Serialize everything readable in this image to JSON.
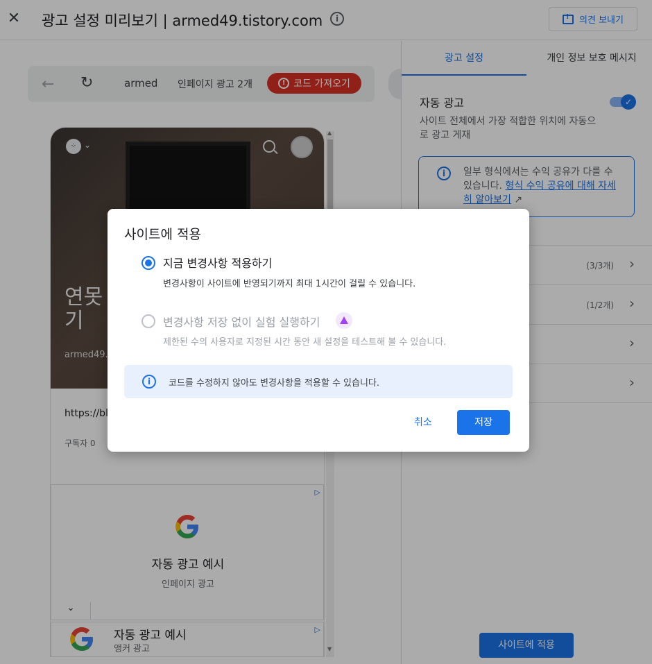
{
  "header": {
    "title": "광고 설정 미리보기 | armed49.tistory.com",
    "feedback_label": "의견 보내기"
  },
  "preview": {
    "toolbar": {
      "site_name": "armed",
      "inpage_count": "인페이지 광고 2개",
      "code_button": "코드 가져오기"
    },
    "blog": {
      "title": "연못기",
      "sub": "armed49.",
      "url": "https://bl",
      "subscribers": "구독자 0"
    },
    "ads": [
      {
        "title": "자동 광고 예시",
        "subtitle": "인페이지 광고"
      },
      {
        "title": "자동 광고 예시",
        "subtitle": "앵커 광고"
      }
    ]
  },
  "sidebar": {
    "tabs": [
      {
        "label": "광고 설정",
        "active": true
      },
      {
        "label": "개인 정보 보호 메시지",
        "active": false
      }
    ],
    "auto_ads": {
      "title": "자동 광고",
      "description": "사이트 전체에서 가장 적합한 위치에 자동으로 광고 게재",
      "enabled": true
    },
    "notice": {
      "text_prefix": "일부 형식에서는 수익 공유가 다를 수 있습니다.",
      "link": "형식 수익 공유에 대해 자세히 알아보기"
    },
    "rows": [
      {
        "count": "(3/3개)"
      },
      {
        "count": "(1/2개)"
      },
      {
        "count": ""
      },
      {
        "count": ""
      }
    ],
    "apply_button": "사이트에 적용"
  },
  "dialog": {
    "title": "사이트에 적용",
    "option1": {
      "label": "지금 변경사항 적용하기",
      "description": "변경사항이 사이트에 반영되기까지 최대 1시간이 걸릴 수 있습니다.",
      "selected": true
    },
    "option2": {
      "label": "변경사항 저장 없이 실험 실행하기",
      "description": "제한된 수의 사용자로 지정된 시간 동안 새 설정을 테스트해 볼 수 있습니다.",
      "selected": false
    },
    "info": "코드를 수정하지 않아도 변경사항을 적용할 수 있습니다.",
    "cancel": "취소",
    "save": "저장"
  },
  "colors": {
    "accent": "#1a73e8",
    "danger": "#d93025"
  }
}
